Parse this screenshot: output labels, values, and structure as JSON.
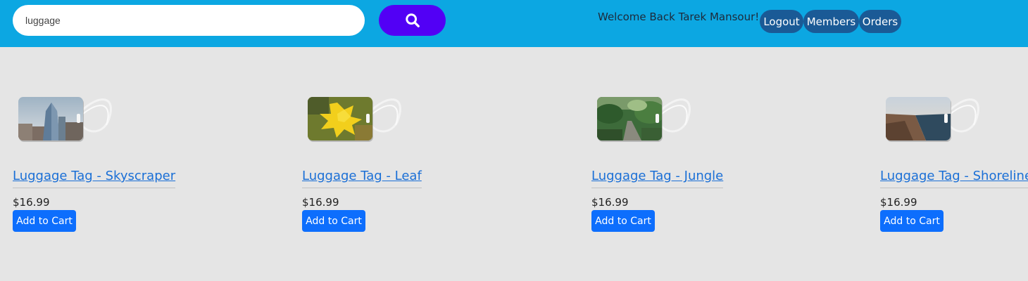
{
  "search": {
    "value": "luggage",
    "icon": "search-icon"
  },
  "header": {
    "welcome": "Welcome Back Tarek Mansour!",
    "logout": "Logout",
    "members": "Members",
    "orders": "Orders"
  },
  "colors": {
    "header_bg": "#0ca7e2",
    "search_button": "#5200f5",
    "nav_button": "#1a5a96",
    "page_bg": "#e5e5e5",
    "link": "#1a6fd6",
    "cart_button": "#0d6efd"
  },
  "products": [
    {
      "title": "Luggage Tag - Skyscraper",
      "price": "$16.99",
      "button": "Add to Cart",
      "image": "skyscraper-tag-image"
    },
    {
      "title": "Luggage Tag - Leaf",
      "price": "$16.99",
      "button": "Add to Cart",
      "image": "leaf-tag-image"
    },
    {
      "title": "Luggage Tag - Jungle",
      "price": "$16.99",
      "button": "Add to Cart",
      "image": "jungle-tag-image"
    },
    {
      "title": "Luggage Tag - Shoreline",
      "price": "$16.99",
      "button": "Add to Cart",
      "image": "shoreline-tag-image"
    }
  ]
}
